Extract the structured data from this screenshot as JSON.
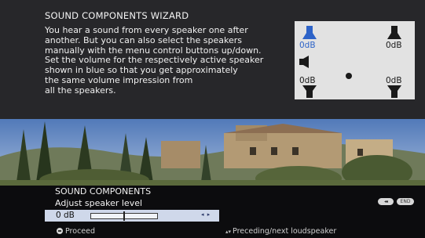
{
  "wizard": {
    "title": "SOUND COMPONENTS WIZARD",
    "lines": [
      "You hear a sound from every speaker one after",
      "another. But you can also select the speakers",
      "manually with the menu control buttons up/down.",
      "Set the volume for the respectively active speaker",
      "shown in blue so that you get approximately",
      "the same volume impression from",
      "all the speakers."
    ]
  },
  "speakers": {
    "front_left": "0dB",
    "front_right": "0dB",
    "rear_left": "0dB",
    "rear_right": "0dB",
    "active_color": "#2d63c8",
    "inactive_color": "#1a1a1a"
  },
  "controls": {
    "title": "SOUND COMPONENTS",
    "subtitle": "Adjust speaker level",
    "level_value": "0 dB",
    "level_fraction": 0.5,
    "level_arrows": "◂ ▸",
    "back_label": "◂◂",
    "end_label": "END",
    "proceed_hint": "Proceed",
    "nav_hint": "Preceding/next loudspeaker"
  }
}
